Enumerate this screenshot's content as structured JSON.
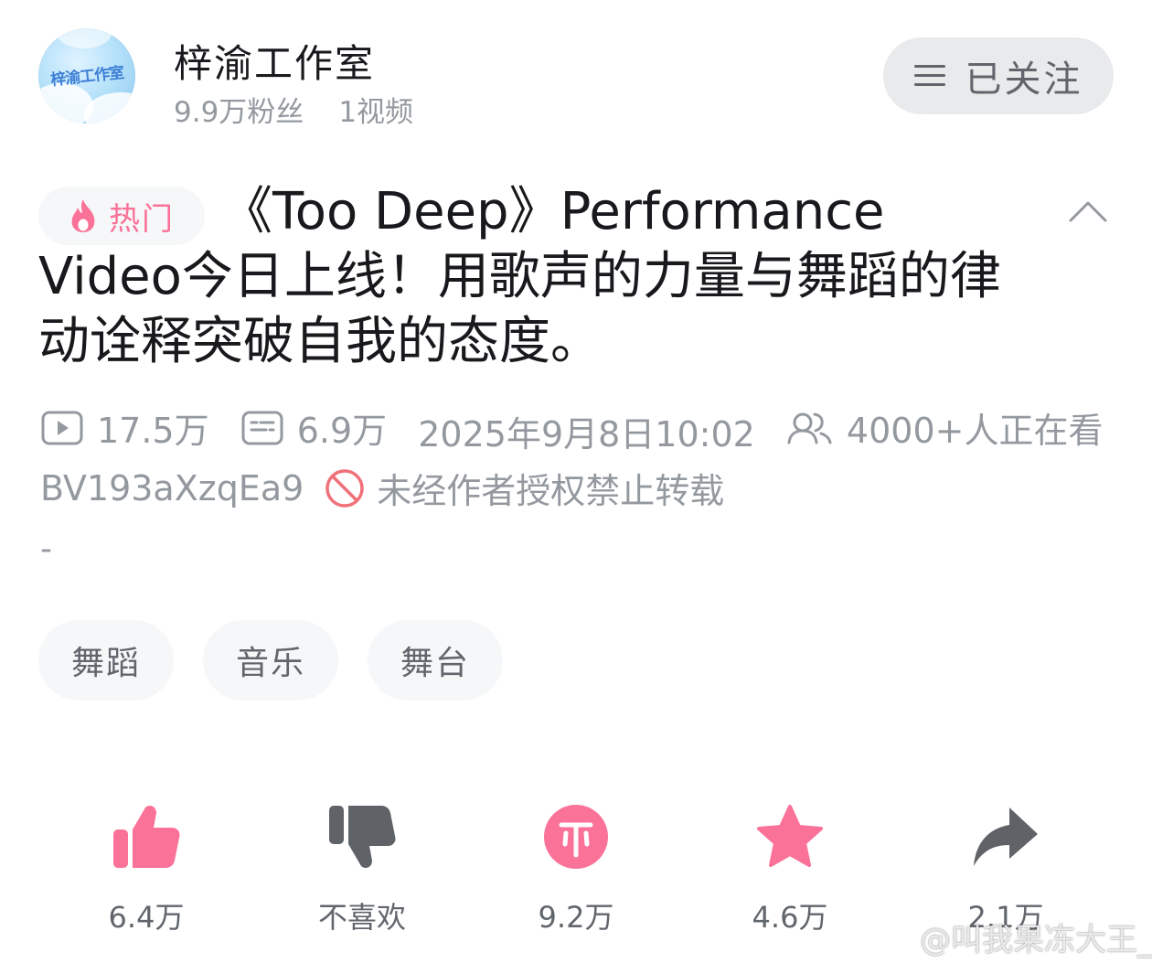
{
  "channel": {
    "avatar_text": "梓渝工作室",
    "name": "梓渝工作室",
    "followers": "9.9万粉丝",
    "videos": "1视频",
    "follow_button": "已关注"
  },
  "video": {
    "hot_tag": "热门",
    "title": "《Too Deep》Performance Video今日上线！用歌声的力量与舞蹈的律动诠释突破自我的态度。",
    "views": "17.5万",
    "danmaku": "6.9万",
    "publish_time": "2025年9月8日10:02",
    "watching": "4000+人正在看",
    "bvid": "BV193aXzqEa9",
    "copyright_notice": "未经作者授权禁止转载",
    "description": "-"
  },
  "tags": [
    "舞蹈",
    "音乐",
    "舞台"
  ],
  "actions": {
    "like": "6.4万",
    "dislike": "不喜欢",
    "coin": "9.2万",
    "favorite": "4.6万",
    "share": "2.1万"
  },
  "watermark": "@叫我果冻大王_",
  "colors": {
    "accent_pink": "#fb7299",
    "secondary_text": "#9499a0",
    "dislike_icon": "#5f6368",
    "follow_bg": "#e9eaec"
  },
  "icons": [
    "menu-icon",
    "flame-icon",
    "chevron-up-icon",
    "play-icon",
    "danmaku-icon",
    "viewers-icon",
    "forbidden-icon",
    "thumb-up-icon",
    "thumb-down-icon",
    "coin-icon",
    "star-icon",
    "share-icon",
    "weibo-icon"
  ]
}
